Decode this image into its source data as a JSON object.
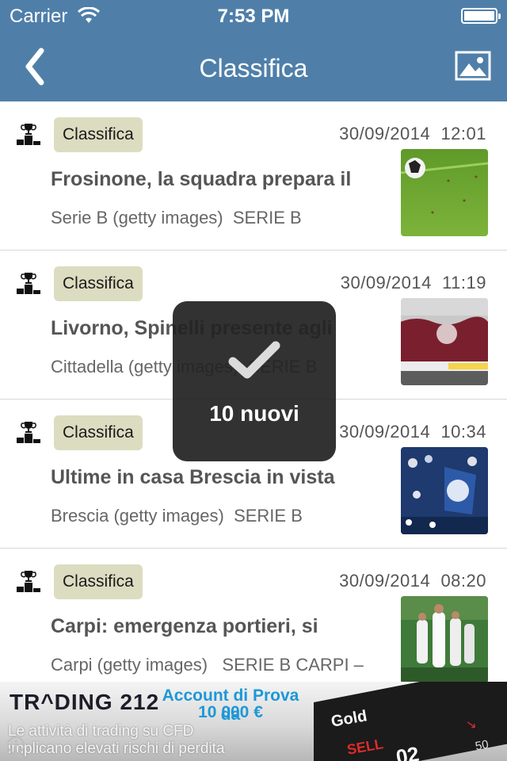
{
  "status_bar": {
    "carrier": "Carrier",
    "time": "7:53 PM",
    "battery_level": 1.0
  },
  "nav": {
    "title": "Classifica",
    "back_icon": "chevron-left-icon",
    "gallery_icon": "photo-gallery-icon"
  },
  "colors": {
    "nav_bar": "#4f7fa9",
    "chip": "#dcdcc1",
    "hud": "#222222"
  },
  "articles": [
    {
      "category": "Classifica",
      "date": "30/09/2014  12:01",
      "headline": "Frosinone, la squadra prepara il",
      "source": "Serie B (getty images)  SERIE B",
      "icon": "podium-trophy-icon",
      "thumbnail": "soccer-ball-on-pitch"
    },
    {
      "category": "Classifica",
      "date": "30/09/2014  11:19",
      "headline": "Livorno, Spinelli presente agli",
      "source": "Cittadella (getty images)  SERIE B",
      "icon": "podium-trophy-icon",
      "thumbnail": "stadium-fans-maroon"
    },
    {
      "category": "Classifica",
      "date": "30/09/2014  10:34",
      "headline": "Ultime in casa Brescia in vista",
      "source": "Brescia (getty images)  SERIE B",
      "icon": "podium-trophy-icon",
      "thumbnail": "stadium-fans-blue"
    },
    {
      "category": "Classifica",
      "date": "30/09/2014  08:20",
      "headline": "Carpi: emergenza portieri, si",
      "source": "Carpi (getty images)   SERIE B CARPI –",
      "icon": "podium-trophy-icon",
      "thumbnail": "players-celebrating"
    }
  ],
  "hud": {
    "icon": "checkmark-icon",
    "text": "10 nuovi"
  },
  "ad": {
    "logo": "TR^DING 212",
    "promo_line1": "Account di Prova da",
    "promo_line2": "10 000 €",
    "disclaimer_line1": "Le attività di trading su CFD",
    "disclaimer_line2": "implicano elevati rischi di perdita",
    "ticker_label": "Gold",
    "sell_label": "SELL",
    "sell_price": "02",
    "ticker_small": "50"
  }
}
